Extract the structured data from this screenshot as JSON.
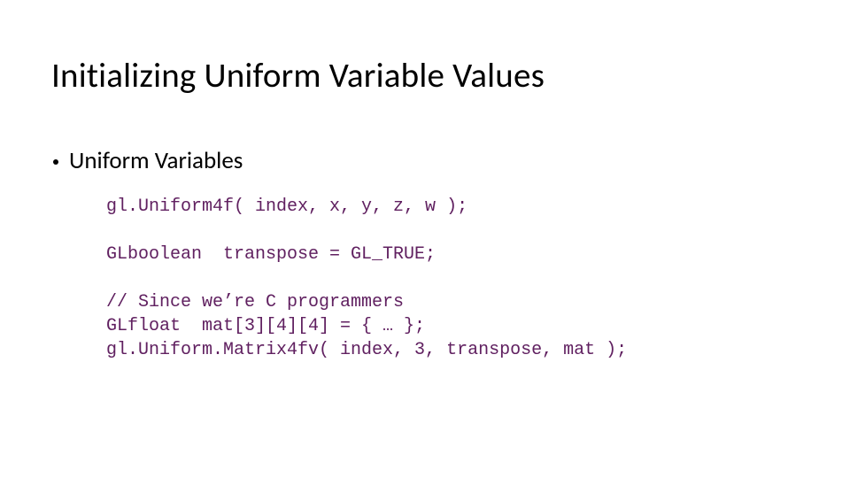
{
  "title": "Initializing Uniform Variable Values",
  "bullet": "Uniform Variables",
  "code": "gl.Uniform4f( index, x, y, z, w );\n\nGLboolean  transpose = GL_TRUE;\n\n// Since we’re C programmers\nGLfloat  mat[3][4][4] = { … };\ngl.Uniform.Matrix4fv( index, 3, transpose, mat );"
}
